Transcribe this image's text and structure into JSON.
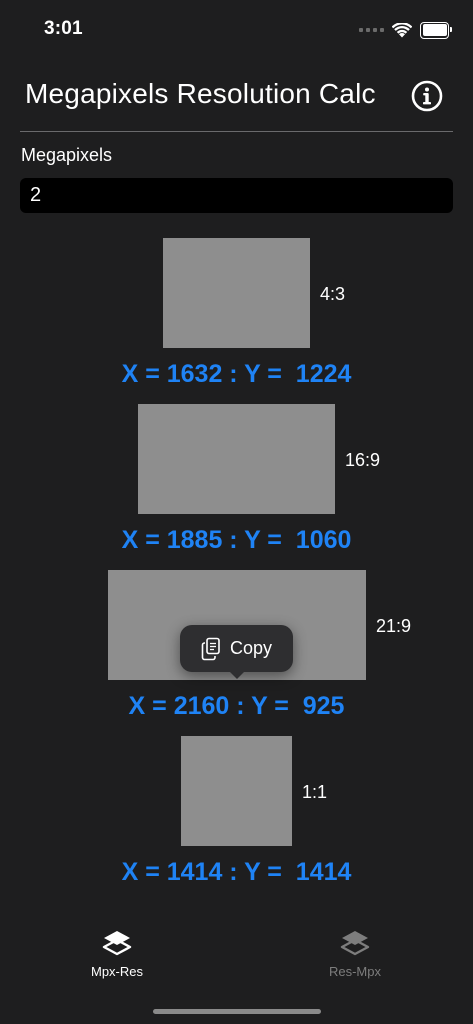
{
  "status_bar": {
    "time": "3:01",
    "icons": [
      "cellular-signal-icon",
      "wifi-icon",
      "battery-icon"
    ]
  },
  "header": {
    "title": "Megapixels Resolution Calc",
    "info_icon": "info-circle-icon"
  },
  "input": {
    "label": "Megapixels",
    "value": "2"
  },
  "results": [
    {
      "ratio": "4:3",
      "text": "X = 1632 : Y =  1224"
    },
    {
      "ratio": "16:9",
      "text": "X = 1885 : Y =  1060"
    },
    {
      "ratio": "21:9",
      "text": "X = 2160 : Y =  925"
    },
    {
      "ratio": "1:1",
      "text": "X = 1414 : Y =  1414"
    }
  ],
  "copy_menu": {
    "label": "Copy",
    "icon": "copy-icon"
  },
  "tab_bar": {
    "tabs": [
      {
        "label": "Mpx-Res",
        "icon": "layers-icon",
        "active": true
      },
      {
        "label": "Res-Mpx",
        "icon": "layers-icon",
        "active": false
      }
    ]
  },
  "colors": {
    "background": "#1e1e1f",
    "accent_blue": "#1f83f5",
    "ratio_box": "#8e8e8e",
    "input_background": "#000000"
  }
}
